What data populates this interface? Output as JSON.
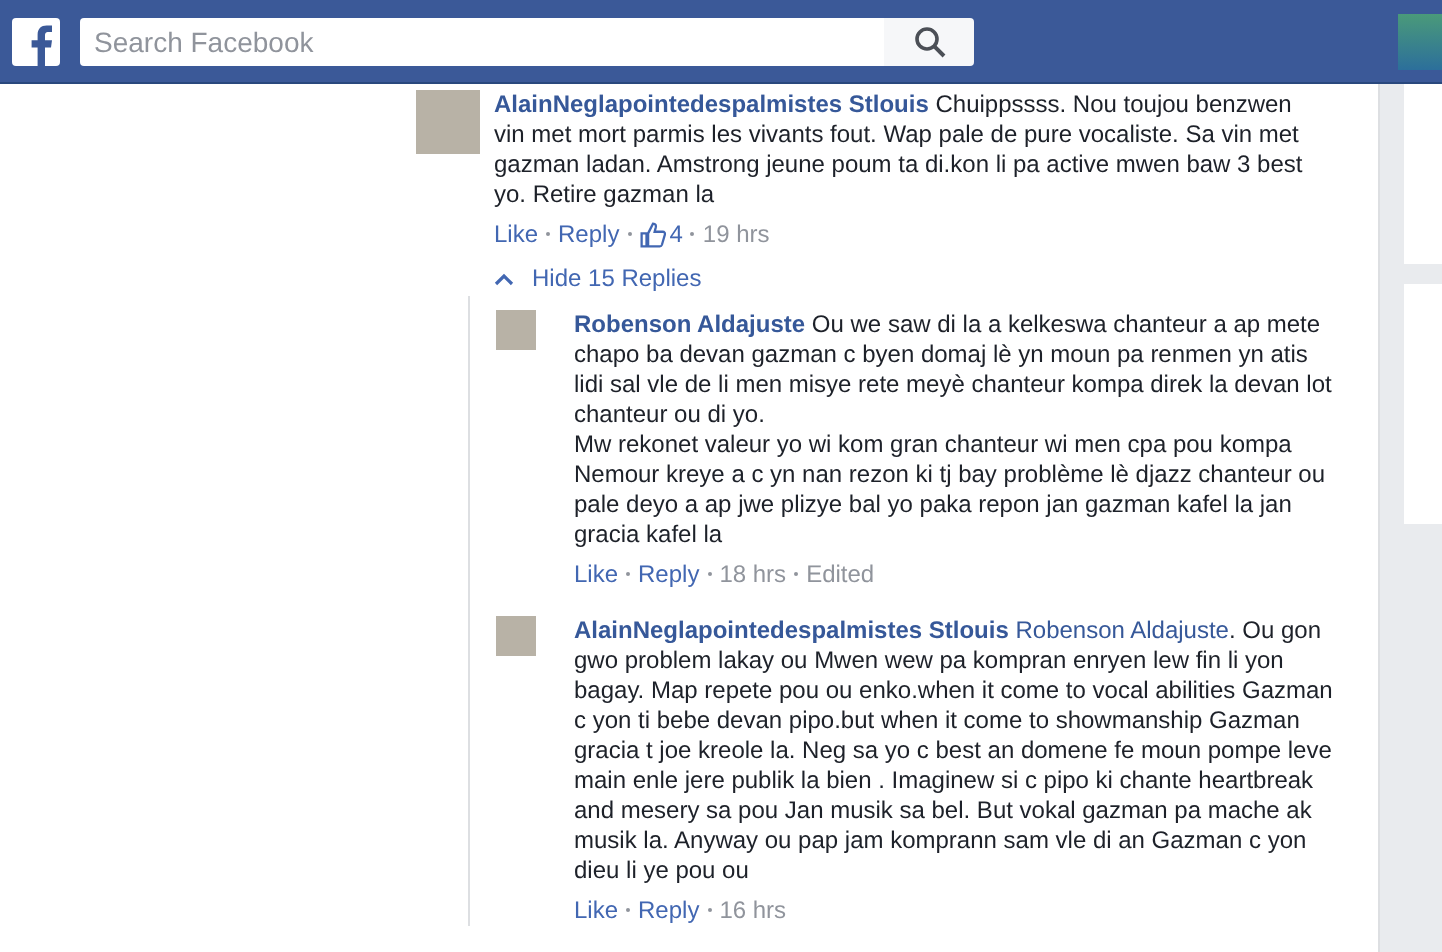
{
  "search": {
    "placeholder": "Search Facebook"
  },
  "comment": {
    "author": "AlainNeglapointedespalmistes Stlouis",
    "text": "Chuippssss. Nou toujou benzwen vin met mort parmis les vivants fout. Wap pale de pure vocaliste. Sa vin met gazman ladan. Amstrong jeune poum ta di.kon li pa active mwen baw 3 best yo. Retire gazman la",
    "actions": [
      "Like",
      "Reply"
    ],
    "likes": "4",
    "time": "19 hrs"
  },
  "replies_toggle": {
    "label": "Hide 15 Replies",
    "expanded": true
  },
  "replies": [
    {
      "author": "Robenson Aldajuste",
      "text": "Ou we saw di la a kelkeswa chanteur a ap mete chapo ba devan gazman c byen domaj lè yn moun pa renmen yn atis lidi sal vle de li men misye rete meyè chanteur kompa direk la devan lot chanteur ou di yo.\nMw rekonet valeur yo wi kom gran chanteur wi men cpa pou kompa Nemour kreye a c yn nan rezon ki tj bay problème lè djazz chanteur ou pale deyo a ap jwe plizye bal yo paka repon jan gazman kafel la jan gracia kafel la",
      "actions": [
        "Like",
        "Reply"
      ],
      "time": "18 hrs",
      "edited": "Edited"
    },
    {
      "author": "AlainNeglapointedespalmistes Stlouis",
      "mention": "Robenson Aldajuste",
      "text": ". Ou gon gwo problem lakay ou Mwen wew pa kompran enryen lew fin li yon bagay. Map repete pou ou enko.when it come to vocal abilities Gazman c yon ti bebe devan pipo.but when it come to showmanship Gazman gracia t joe kreole la. Neg sa yo c best an domene fe moun pompe leve main enle jere publik la bien . Imaginew si c pipo ki chante heartbreak and mesery sa pou Jan musik sa bel. But vokal gazman pa mache ak musik la. Anyway ou pap jam komprann sam vle di an Gazman c yon dieu li ye pou ou",
      "actions": [
        "Like",
        "Reply"
      ],
      "time": "16 hrs"
    }
  ]
}
